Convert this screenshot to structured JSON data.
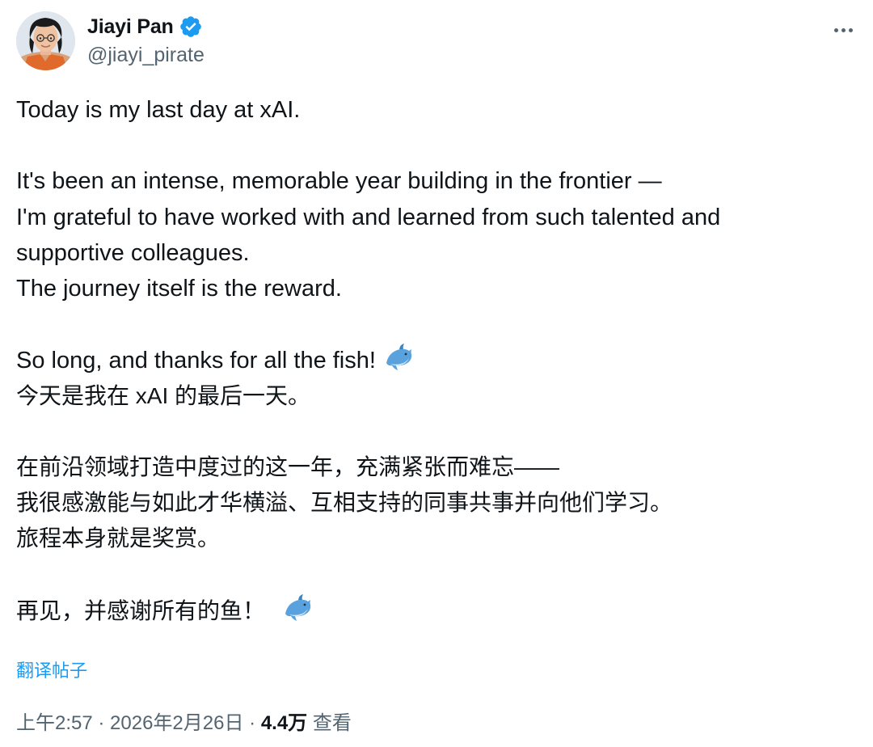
{
  "author": {
    "display_name": "Jiayi Pan",
    "handle": "@jiayi_pirate",
    "verified": true
  },
  "icons": {
    "avatar": "avatar",
    "verified": "verified-badge-icon",
    "more": "more-options-icon",
    "emoji": "dolphin-emoji-icon"
  },
  "tweet": {
    "en_line1": "Today is my last day at xAI.",
    "en_line2": "It's been an intense, memorable year building in the frontier —",
    "en_line3": "I'm grateful to have worked with and learned from such talented and",
    "en_line4": "supportive colleagues.",
    "en_line5": "The journey itself is the reward.",
    "en_line6": "So long, and thanks for all the fish!",
    "zh_line1": "今天是我在 xAI 的最后一天。",
    "zh_line2": "在前沿领域打造中度过的这一年，充满紧张而难忘——",
    "zh_line3": "我很感激能与如此才华横溢、互相支持的同事共事并向他们学习。",
    "zh_line4": "旅程本身就是奖赏。",
    "zh_line5": "再见，并感谢所有的鱼！"
  },
  "translate_label": "翻译帖子",
  "meta": {
    "time": "上午2:57",
    "separator": " · ",
    "date": "2026年2月26日",
    "views_count": "4.4万",
    "views_label": " 查看"
  },
  "colors": {
    "text": "#0f1419",
    "secondary": "#536471",
    "accent": "#1d9bf0"
  }
}
